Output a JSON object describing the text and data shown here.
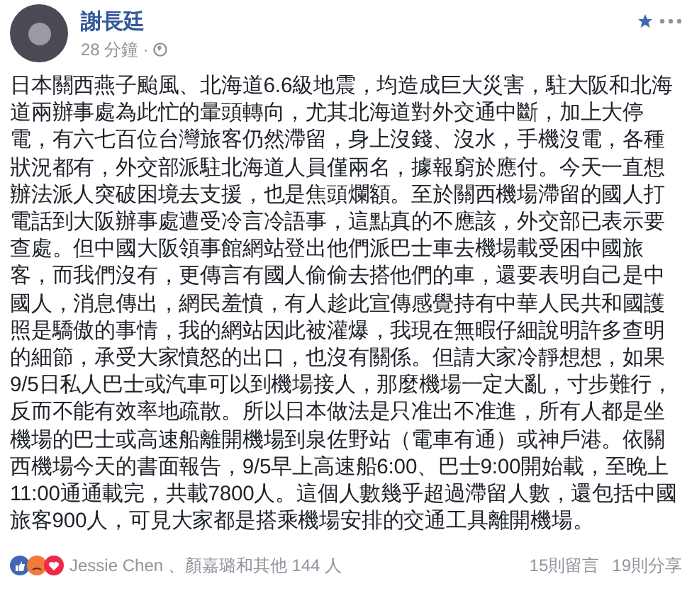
{
  "post": {
    "author": "謝長廷",
    "time": "28 分鐘",
    "separator": "·",
    "body": "日本關西燕子颱風、北海道6.6級地震，均造成巨大災害，駐大阪和北海道兩辦事處為此忙的暈頭轉向，尤其北海道對外交通中斷，加上大停電，有六七百位台灣旅客仍然滯留，身上沒錢、沒水，手機沒電，各種狀況都有，外交部派駐北海道人員僅兩名，據報窮於應付。今天一直想辦法派人突破困境去支援，也是焦頭爛額。至於關西機場滯留的國人打電話到大阪辦事處遭受冷言冷語事，這點真的不應該，外交部已表示要查處。但中國大阪領事館網站登出他們派巴士車去機場載受困中國旅客，而我們沒有，更傳言有國人偷偷去搭他們的車，還要表明自己是中國人，消息傳出，網民羞憤，有人趁此宣傳感覺持有中華人民共和國護照是驕傲的事情，我的網站因此被灌爆，我現在無暇仔細說明許多查明的細節，承受大家憤怒的出口，也沒有關係。但請大家冷靜想想，如果9/5日私人巴士或汽車可以到機場接人，那麼機場一定大亂，寸步難行，反而不能有效率地疏散。所以日本做法是只准出不准進，所有人都是坐機場的巴士或高速船離開機場到泉佐野站（電車有通）或神戶港。依關西機場今天的書面報告，9/5早上高速船6:00、巴士9:00開始載，至晚上11:00通通載完，共載7800人。這個人數幾乎超過滯留人數，還包括中國旅客900人，可見大家都是搭乘機場安排的交通工具離開機場。"
  },
  "footer": {
    "reactors": "Jessie Chen 、顏嘉璐和其他 144 人",
    "comments": "15則留言",
    "shares": "19則分享"
  }
}
